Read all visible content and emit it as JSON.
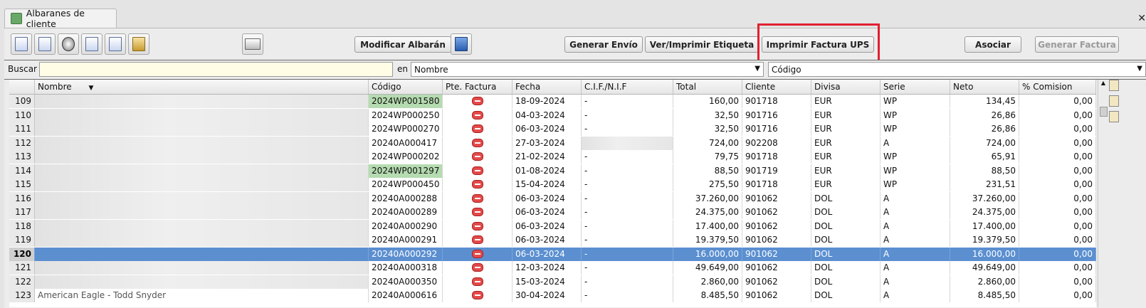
{
  "window": {
    "tab_label": "Albaranes de cliente"
  },
  "toolbar": {
    "modificar": "Modificar Albarán",
    "generar_envio": "Generar Envío",
    "ver_imprimir_etiqueta": "Ver/Imprimir Etiqueta",
    "imprimir_factura_ups": "Imprimir Factura UPS",
    "asociar": "Asociar",
    "generar_factura": "Generar Factura"
  },
  "search": {
    "label": "Buscar",
    "value": "",
    "in_label": "en",
    "field_select": "Nombre",
    "order_select": "Código"
  },
  "table": {
    "columns": [
      "Nombre",
      "Código",
      "Pte. Factura",
      "Fecha",
      "C.I.F./N.I.F",
      "Total",
      "Cliente",
      "Divisa",
      "Serie",
      "Neto",
      "% Comision"
    ],
    "rows": [
      {
        "n": "109",
        "nombre": "",
        "codigo": "2024WP001580",
        "fecha": "18-09-2024",
        "cif": "-",
        "total": "160,00",
        "cliente": "901718",
        "divisa": "EUR",
        "serie": "WP",
        "neto": "134,45",
        "comision": "0,00"
      },
      {
        "n": "110",
        "nombre": "",
        "codigo": "2024WP000250",
        "fecha": "04-03-2024",
        "cif": "-",
        "total": "32,50",
        "cliente": "901716",
        "divisa": "EUR",
        "serie": "WP",
        "neto": "26,86",
        "comision": "0,00"
      },
      {
        "n": "111",
        "nombre": "",
        "codigo": "2024WP000270",
        "fecha": "06-03-2024",
        "cif": "-",
        "total": "32,50",
        "cliente": "901716",
        "divisa": "EUR",
        "serie": "WP",
        "neto": "26,86",
        "comision": "0,00"
      },
      {
        "n": "112",
        "nombre": "",
        "codigo": "20240A000417",
        "fecha": "27-03-2024",
        "cif": "",
        "total": "724,00",
        "cliente": "902208",
        "divisa": "EUR",
        "serie": "A",
        "neto": "724,00",
        "comision": "0,00"
      },
      {
        "n": "113",
        "nombre": "",
        "codigo": "2024WP000202",
        "fecha": "21-02-2024",
        "cif": "-",
        "total": "79,75",
        "cliente": "901718",
        "divisa": "EUR",
        "serie": "WP",
        "neto": "65,91",
        "comision": "0,00"
      },
      {
        "n": "114",
        "nombre": "",
        "codigo": "2024WP001297",
        "fecha": "01-08-2024",
        "cif": "-",
        "total": "88,50",
        "cliente": "901719",
        "divisa": "EUR",
        "serie": "WP",
        "neto": "88,50",
        "comision": "0,00"
      },
      {
        "n": "115",
        "nombre": "",
        "codigo": "2024WP000450",
        "fecha": "15-04-2024",
        "cif": "-",
        "total": "275,50",
        "cliente": "901718",
        "divisa": "EUR",
        "serie": "WP",
        "neto": "231,51",
        "comision": "0,00"
      },
      {
        "n": "116",
        "nombre": "",
        "codigo": "20240A000288",
        "fecha": "06-03-2024",
        "cif": "-",
        "total": "37.260,00",
        "cliente": "901062",
        "divisa": "DOL",
        "serie": "A",
        "neto": "37.260,00",
        "comision": "0,00"
      },
      {
        "n": "117",
        "nombre": "",
        "codigo": "20240A000289",
        "fecha": "06-03-2024",
        "cif": "-",
        "total": "24.375,00",
        "cliente": "901062",
        "divisa": "DOL",
        "serie": "A",
        "neto": "24.375,00",
        "comision": "0,00"
      },
      {
        "n": "118",
        "nombre": "",
        "codigo": "20240A000290",
        "fecha": "06-03-2024",
        "cif": "-",
        "total": "17.400,00",
        "cliente": "901062",
        "divisa": "DOL",
        "serie": "A",
        "neto": "17.400,00",
        "comision": "0,00"
      },
      {
        "n": "119",
        "nombre": "",
        "codigo": "20240A000291",
        "fecha": "06-03-2024",
        "cif": "-",
        "total": "19.379,50",
        "cliente": "901062",
        "divisa": "DOL",
        "serie": "A",
        "neto": "19.379,50",
        "comision": "0,00"
      },
      {
        "n": "120",
        "nombre": "",
        "codigo": "20240A000292",
        "fecha": "06-03-2024",
        "cif": "-",
        "total": "16.000,00",
        "cliente": "901062",
        "divisa": "DOL",
        "serie": "A",
        "neto": "16.000,00",
        "comision": "0,00"
      },
      {
        "n": "121",
        "nombre": "",
        "codigo": "20240A000318",
        "fecha": "12-03-2024",
        "cif": "-",
        "total": "49.649,00",
        "cliente": "901062",
        "divisa": "DOL",
        "serie": "A",
        "neto": "49.649,00",
        "comision": "0,00"
      },
      {
        "n": "122",
        "nombre": "",
        "codigo": "20240A000350",
        "fecha": "15-03-2024",
        "cif": "-",
        "total": "2.860,00",
        "cliente": "901062",
        "divisa": "DOL",
        "serie": "A",
        "neto": "2.860,00",
        "comision": "0,00"
      },
      {
        "n": "123",
        "nombre": "American Eagle - Todd Snyder",
        "codigo": "20240A000616",
        "fecha": "30-04-2024",
        "cif": "-",
        "total": "8.485,50",
        "cliente": "901062",
        "divisa": "DOL",
        "serie": "A",
        "neto": "8.485,50",
        "comision": "0,00"
      }
    ]
  },
  "colors": {
    "selected_row": "#5b8fd0",
    "codigo_highlight": "#b5dbb0",
    "annotation_box": "#e02030"
  },
  "icons": [
    "new-doc-icon",
    "edit-doc-icon",
    "stop-icon",
    "envelope-icon",
    "copy-doc-icon",
    "lock-icon",
    "print-icon",
    "book-icon",
    "pending-invoice-icon"
  ]
}
